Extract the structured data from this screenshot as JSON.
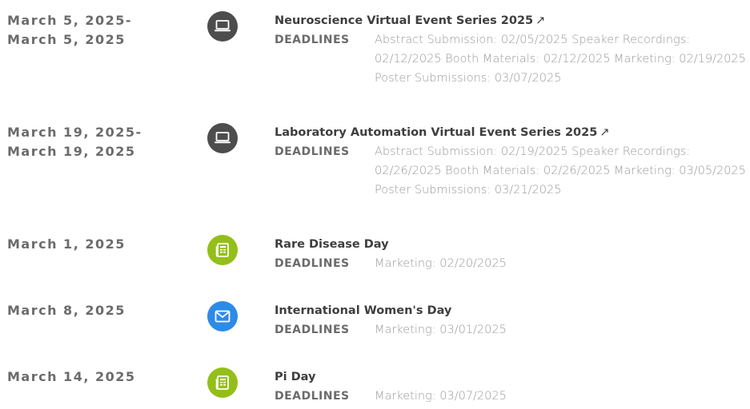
{
  "label_deadlines": "DEADLINES",
  "colors": {
    "virtual": "#4d4d4d",
    "print": "#94bf19",
    "email": "#2d8be8"
  },
  "events": [
    {
      "date_start": "March 5, 2025-",
      "date_end": "March 5, 2025",
      "icon": "laptop-icon",
      "title": "Neuroscience Virtual Event Series 2025",
      "external": "↗",
      "deadlines": "Abstract Submission: 02/05/2025 Speaker Recordings: 02/12/2025 Booth Materials: 02/12/2025 Marketing: 02/19/2025 Poster Submissions: 03/07/2025"
    },
    {
      "date_start": "March 19, 2025-",
      "date_end": "March 19, 2025",
      "icon": "laptop-icon",
      "title": "Laboratory Automation Virtual Event Series 2025",
      "external": "↗",
      "deadlines": "Abstract Submission: 02/19/2025 Speaker Recordings: 02/26/2025 Booth Materials: 02/26/2025 Marketing: 03/05/2025 Poster Submissions: 03/21/2025"
    },
    {
      "date": "March 1, 2025",
      "icon": "newspaper-icon",
      "title": "Rare Disease Day",
      "deadlines": "Marketing: 02/20/2025"
    },
    {
      "date": "March 8, 2025",
      "icon": "envelope-icon",
      "title": "International Women's Day",
      "deadlines": "Marketing: 03/01/2025"
    },
    {
      "date": "March 14, 2025",
      "icon": "newspaper-icon",
      "title": "Pi Day",
      "deadlines": "Marketing: 03/07/2025"
    }
  ]
}
